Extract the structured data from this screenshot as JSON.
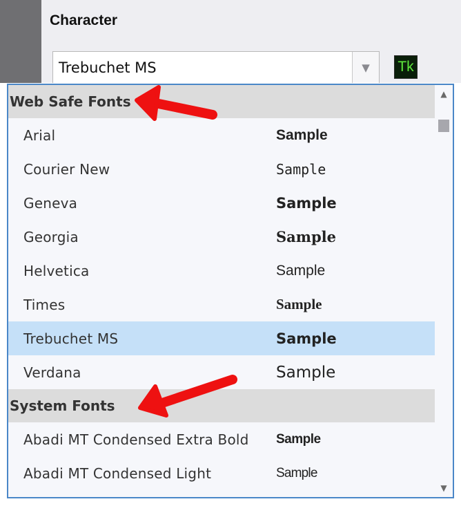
{
  "panel": {
    "title": "Character",
    "font_select_value": "Trebuchet MS",
    "typekit_label": "Tk"
  },
  "dropdown": {
    "groups": [
      {
        "label": "Web Safe Fonts",
        "fonts": [
          {
            "name": "Arial",
            "sample": "Sample"
          },
          {
            "name": "Courier New",
            "sample": "Sample"
          },
          {
            "name": "Geneva",
            "sample": "Sample"
          },
          {
            "name": "Georgia",
            "sample": "Sample"
          },
          {
            "name": "Helvetica",
            "sample": "Sample"
          },
          {
            "name": "Times",
            "sample": "Sample"
          },
          {
            "name": "Trebuchet MS",
            "sample": "Sample",
            "selected": true
          },
          {
            "name": "Verdana",
            "sample": "Sample"
          }
        ]
      },
      {
        "label": "System Fonts",
        "fonts": [
          {
            "name": "Abadi MT Condensed Extra Bold",
            "sample": "Sample"
          },
          {
            "name": "Abadi MT Condensed Light",
            "sample": "Sample"
          }
        ]
      }
    ]
  },
  "icons": {
    "select_arrow": "chevron-down-icon",
    "scroll_up": "scroll-up-arrow-icon",
    "scroll_down": "scroll-down-arrow-icon",
    "annotation": "red-arrow-icon"
  },
  "colors": {
    "selection": "#c5e0f8",
    "group_header_bg": "#dcdcdc",
    "dropdown_border": "#4a87c8",
    "typekit_green": "#5ee63c",
    "annotation_red": "#ee1111"
  }
}
